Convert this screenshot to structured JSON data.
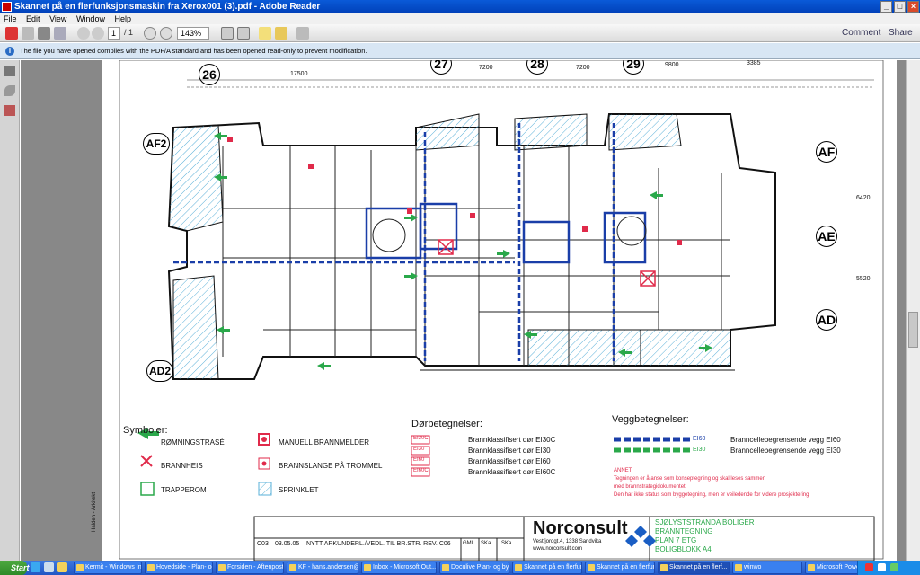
{
  "window": {
    "title": "Skannet på en flerfunksjonsmaskin fra Xerox001 (3).pdf - Adobe Reader"
  },
  "menu": [
    "File",
    "Edit",
    "View",
    "Window",
    "Help"
  ],
  "toolbar": {
    "page_current": "1",
    "page_total": "/ 1",
    "zoom": "143%",
    "comment": "Comment",
    "share": "Share"
  },
  "infobar": {
    "message": "The file you have opened complies with the PDF/A standard and has been opened read-only to prevent modification."
  },
  "drawing": {
    "gridlines": [
      "26",
      "27",
      "28",
      "29",
      "AF2",
      "AF",
      "AE",
      "AD",
      "AD2"
    ],
    "dims": [
      "17500",
      "7200",
      "7200",
      "9800",
      "3385",
      "6420",
      "5520"
    ],
    "symbols_title": "Symboler:",
    "symbols": [
      "RØMNINGSTRASÉ",
      "BRANNHEIS",
      "TRAPPEROM",
      "MANUELL BRANNMELDER",
      "BRANNSLANGE PÅ TROMMEL",
      "SPRINKLET"
    ],
    "doors_title": "Dørbetegnelser:",
    "doors": [
      {
        "code": "EI30C",
        "text": "Brannklassifisert dør EI30C"
      },
      {
        "code": "EI30",
        "text": "Brannklassifisert dør EI30"
      },
      {
        "code": "EI60",
        "text": "Brannklassifisert dør EI60"
      },
      {
        "code": "EI60C",
        "text": "Brannklassifisert dør EI60C"
      }
    ],
    "walls_title": "Veggbetegnelser:",
    "walls": [
      {
        "code": "EI60",
        "text": "Branncellebegrensende vegg EI60"
      },
      {
        "code": "EI30",
        "text": "Branncellebegrensende vegg EI30"
      }
    ],
    "annet_title": "ANNET",
    "annet_lines": [
      "Tegningen er å anse som konseptegning og skal leses sammen",
      "med brannstrategidokumentet.",
      "Den har ikke status som byggetegning, men er veiledende for videre prosjektering"
    ],
    "company": "Norconsult",
    "company_address": "Vestfjordgt.4, 1338 Sandvika",
    "company_web": "www.norconsult.com",
    "project_lines": [
      "SJØLYSTSTRANDA BOLIGER",
      "BRANNTEGNING",
      "PLAN 7 ETG",
      "BOLIGBLOKK A4"
    ],
    "revision": {
      "rev": "C03",
      "date": "03.05.05",
      "text": "NYTT ARKUNDERL./VEDL. TIL BR.STR. REV. C06",
      "a": "GML",
      "b": "SKa",
      "c": "SKa"
    },
    "side_stamp": "Halden - Arkitekt"
  },
  "taskbar": {
    "start": "Start",
    "tasks": [
      "Kermit - Windows Int...",
      "Hovedside - Plan- og ...",
      "Forsiden - Aftenpost...",
      "KF - hans.andersen@...",
      "Inbox - Microsoft Out...",
      "Doculive Plan- og byg...",
      "Skannet på en flerfun...",
      "Skannet på en flerfun...",
      "Skannet på en flerf...",
      "winwo",
      "Microsoft PowerPoint ..."
    ]
  },
  "colors": {
    "titlebar": "#0a5ad8",
    "exit_arrow": "#2aa84a",
    "fire_red": "#e02a4a",
    "wall_blue": "#1a3ea8",
    "sprinkler_hatch": "#5ab0d8"
  }
}
